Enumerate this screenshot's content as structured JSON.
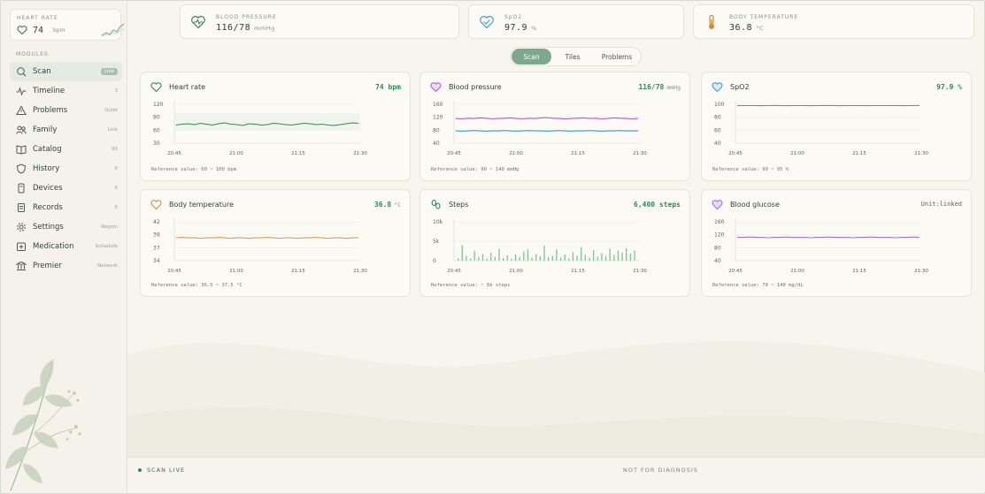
{
  "sidebar": {
    "heart_card": {
      "label": "HEART RATE",
      "value": "74",
      "unit": "bpm"
    },
    "modules_heading": "MODULES",
    "items": [
      {
        "label": "Scan",
        "meta": "Live",
        "icon": "scan-icon"
      },
      {
        "label": "Timeline",
        "meta": "3",
        "icon": "pulse-icon"
      },
      {
        "label": "Problems",
        "meta": "Quiet",
        "icon": "warning-icon"
      },
      {
        "label": "Family",
        "meta": "Link",
        "icon": "people-icon"
      },
      {
        "label": "Catalog",
        "meta": "92",
        "icon": "book-icon"
      },
      {
        "label": "History",
        "meta": "9",
        "icon": "shield-icon"
      },
      {
        "label": "Devices",
        "meta": "5",
        "icon": "device-icon"
      },
      {
        "label": "Records",
        "meta": "5",
        "icon": "records-icon"
      },
      {
        "label": "Settings",
        "meta": "Region",
        "icon": "gear-icon"
      },
      {
        "label": "Medication",
        "meta": "Schedule",
        "icon": "medication-icon"
      },
      {
        "label": "Premier",
        "meta": "Network",
        "icon": "bank-icon"
      }
    ]
  },
  "stats": {
    "bp": {
      "label": "BLOOD PRESSURE",
      "value": "116/78",
      "unit": "mmHg"
    },
    "spo2": {
      "label": "SpO2",
      "value": "97.9",
      "unit": "%"
    },
    "temp": {
      "label": "BODY TEMPERATURE",
      "value": "36.8",
      "unit": "°C"
    }
  },
  "tabs": [
    "Scan",
    "Tiles",
    "Problems"
  ],
  "cards": {
    "hr": {
      "title": "Heart rate",
      "value": "74 bpm",
      "unit": "",
      "ref": "Reference value: 60 ~ 100 bpm"
    },
    "bp": {
      "title": "Blood pressure",
      "value": "116/78",
      "unit": "mmHg",
      "ref": "Reference value: 90 ~ 140 mmHg"
    },
    "spo2": {
      "title": "SpO2",
      "value": "97.9 %",
      "unit": "",
      "ref": "Reference value: 90 ~ 95 %"
    },
    "temp": {
      "title": "Body temperature",
      "value": "36.8",
      "unit": "°C",
      "ref": "Reference value: 36.5 ~ 37.5 °C"
    },
    "steps": {
      "title": "Steps",
      "value": "6,400 steps",
      "unit": "",
      "ref": "Reference value: ~ 8k steps"
    },
    "glucose": {
      "title": "Blood glucose",
      "value": "Unit:linked",
      "unit": "",
      "ref": "Reference value: 70 ~ 140 mg/dL"
    }
  },
  "colors": {
    "green": "#2f8a55",
    "purple": "#b05ad0",
    "blue": "#3f9ad6",
    "orange": "#d9a04a",
    "steps": "#7cc496",
    "violet": "#9a76e0"
  },
  "chart_data": [
    {
      "type": "line",
      "title": "Heart rate",
      "x": [
        "20:45",
        "21:00",
        "21:15",
        "21:30"
      ],
      "ylim": [
        30,
        120
      ],
      "yticks": [
        120,
        90,
        60,
        30
      ],
      "series": [
        {
          "name": "Heart rate",
          "values": [
            72,
            74,
            75,
            73,
            76,
            74,
            72,
            75,
            77,
            74,
            73,
            71,
            75,
            74,
            72,
            73,
            76,
            75,
            73,
            72,
            74,
            76,
            75,
            73,
            74,
            72,
            71,
            73,
            75,
            77,
            76
          ]
        }
      ]
    },
    {
      "type": "line",
      "title": "Blood pressure",
      "x": [
        "20:45",
        "21:00",
        "21:15",
        "21:30"
      ],
      "ylim": [
        40,
        160
      ],
      "yticks": [
        160,
        120,
        80,
        40
      ],
      "series": [
        {
          "name": "systolic",
          "values": [
            116,
            115,
            117,
            116,
            118,
            117,
            115,
            116,
            117,
            118,
            116,
            115,
            117,
            116,
            118,
            119,
            117,
            116,
            115,
            116,
            117,
            118,
            116,
            117,
            115,
            116,
            118,
            117,
            116,
            115,
            116
          ]
        },
        {
          "name": "diastolic",
          "values": [
            78,
            77,
            78,
            79,
            78,
            77,
            78,
            78,
            79,
            78,
            77,
            78,
            79,
            78,
            78,
            77,
            78,
            79,
            78,
            77,
            78,
            78,
            79,
            78,
            77,
            78,
            78,
            79,
            78,
            78,
            78
          ]
        }
      ]
    },
    {
      "type": "line",
      "title": "SpO2",
      "x": [
        "20:45",
        "21:00",
        "21:15",
        "21:30"
      ],
      "ylim": [
        40,
        100
      ],
      "yticks": [
        100,
        80,
        60,
        40
      ],
      "series": [
        {
          "name": "SpO2",
          "values": [
            97.8,
            97.9,
            98,
            97.9,
            97.8,
            98,
            98.1,
            97.9,
            97.8,
            97.9,
            98,
            97.9,
            97.8,
            97.9,
            98,
            98.1,
            97.9,
            97.8,
            97.9,
            98,
            97.9,
            97.8,
            97.9,
            98,
            97.9,
            98,
            97.9,
            97.8,
            97.9,
            98,
            97.9
          ]
        }
      ]
    },
    {
      "type": "line",
      "title": "Body temperature",
      "x": [
        "20:45",
        "21:00",
        "21:15",
        "21:30"
      ],
      "ylim": [
        34,
        42
      ],
      "yticks": [
        42,
        39,
        37,
        34
      ],
      "series": [
        {
          "name": "Body temperature",
          "values": [
            38.7,
            38.8,
            38.7,
            38.7,
            38.6,
            38.7,
            38.7,
            38.8,
            38.7,
            38.6,
            38.7,
            38.7,
            38.6,
            38.7,
            38.7,
            38.8,
            38.7,
            38.6,
            38.7,
            38.7,
            38.6,
            38.7,
            38.7,
            38.8,
            38.7,
            38.6,
            38.7,
            38.7,
            38.6,
            38.7,
            38.7
          ]
        }
      ]
    },
    {
      "type": "bar",
      "title": "Steps",
      "x": [
        "20:45",
        "21:00",
        "21:15",
        "21:30"
      ],
      "ylim": [
        0,
        10000
      ],
      "yticks": [
        "10k",
        "5k",
        "0"
      ],
      "series": [
        {
          "name": "Steps",
          "values": [
            600,
            4000,
            1200,
            600,
            2600,
            900,
            1700,
            500,
            2000,
            1000,
            3100,
            700,
            1400,
            500,
            1600,
            900,
            2400,
            2900,
            800,
            1700,
            1100,
            3900,
            900,
            1300,
            2900,
            800,
            1600,
            600,
            2200,
            1300,
            3500,
            1500,
            800,
            2700,
            1000,
            1900,
            1200,
            3100,
            1500,
            2600,
            2100,
            3200,
            1800,
            2600
          ]
        }
      ]
    },
    {
      "type": "line",
      "title": "Blood glucose",
      "x": [
        "20:45",
        "21:00",
        "21:15",
        "21:30"
      ],
      "ylim": [
        40,
        160
      ],
      "yticks": [
        160,
        120,
        80,
        40
      ],
      "series": [
        {
          "name": "Blood glucose",
          "values": [
            112,
            112,
            113,
            112,
            112,
            111,
            112,
            112,
            113,
            112,
            112,
            112,
            111,
            112,
            112,
            113,
            112,
            112,
            112,
            111,
            112,
            112,
            113,
            112,
            112,
            112,
            111,
            112,
            112,
            113,
            112
          ]
        }
      ]
    }
  ],
  "footer": {
    "live": "SCAN LIVE",
    "disclaimer": "NOT FOR DIAGNOSIS"
  }
}
